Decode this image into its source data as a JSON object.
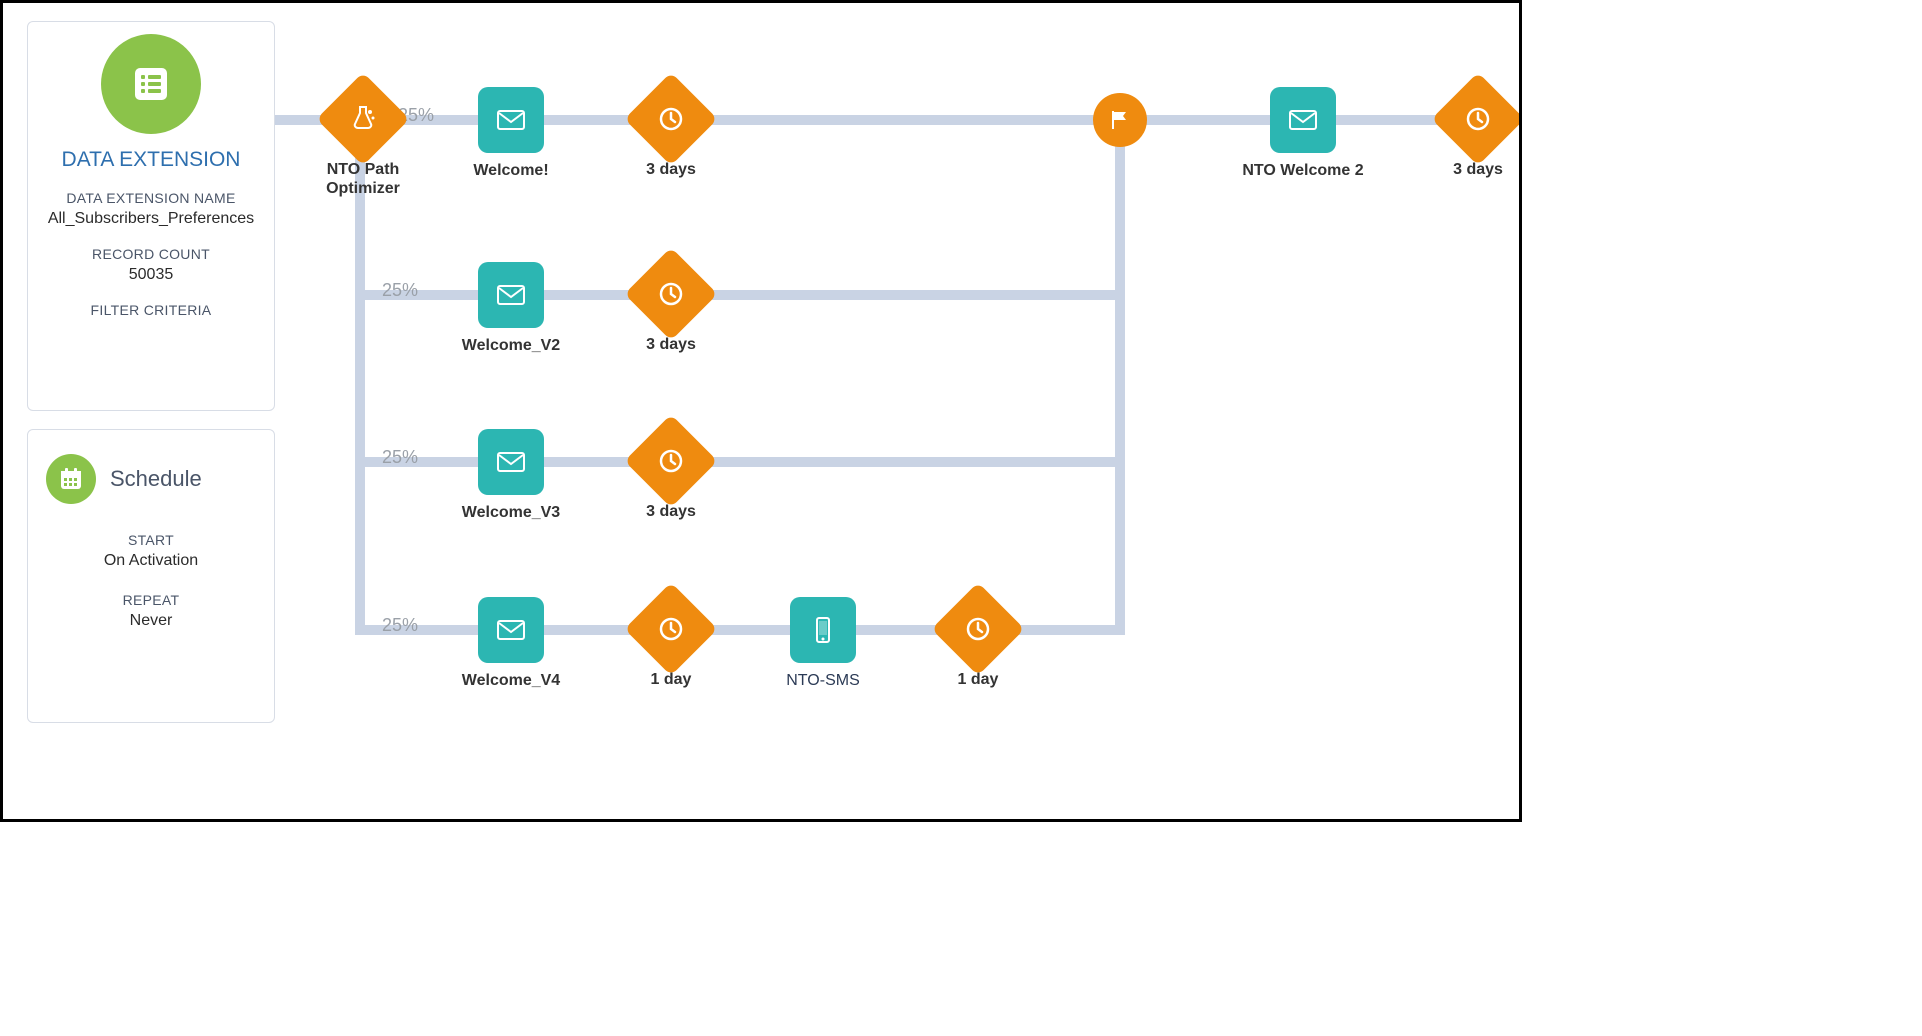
{
  "dataExtension": {
    "title": "DATA EXTENSION",
    "nameLabel": "DATA EXTENSION NAME",
    "nameValue": "All_Subscribers_Preferences",
    "recordLabel": "RECORD COUNT",
    "recordValue": "50035",
    "filterLabel": "FILTER CRITERIA"
  },
  "schedule": {
    "title": "Schedule",
    "startLabel": "START",
    "startValue": "On Activation",
    "repeatLabel": "REPEAT",
    "repeatValue": "Never"
  },
  "paths": {
    "optimizer": "NTO Path Optimizer",
    "pct1": "25%",
    "pct2": "25%",
    "pct3": "25%",
    "pct4": "25%",
    "welcome1": "Welcome!",
    "welcome2": "Welcome_V2",
    "welcome3": "Welcome_V3",
    "welcome4": "Welcome_V4",
    "wait3": "3 days",
    "wait1": "1 day",
    "sms": "NTO-SMS",
    "nto2": "NTO Welcome 2"
  }
}
